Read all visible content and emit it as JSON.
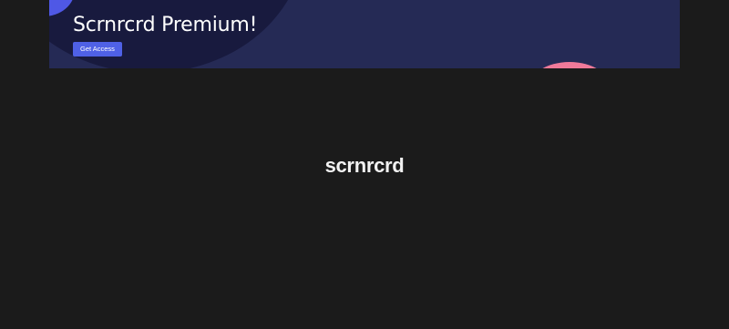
{
  "banner": {
    "title": "Scrnrcrd Premium!",
    "cta_label": "Get Access",
    "colors": {
      "background": "#252a55",
      "accent_blue": "#4f58e6",
      "accent_pink": "#f07a9a",
      "button": "#4f61e6"
    }
  },
  "logo": {
    "text": "scrnrcrd"
  },
  "page": {
    "background": "#1b1b1b"
  }
}
